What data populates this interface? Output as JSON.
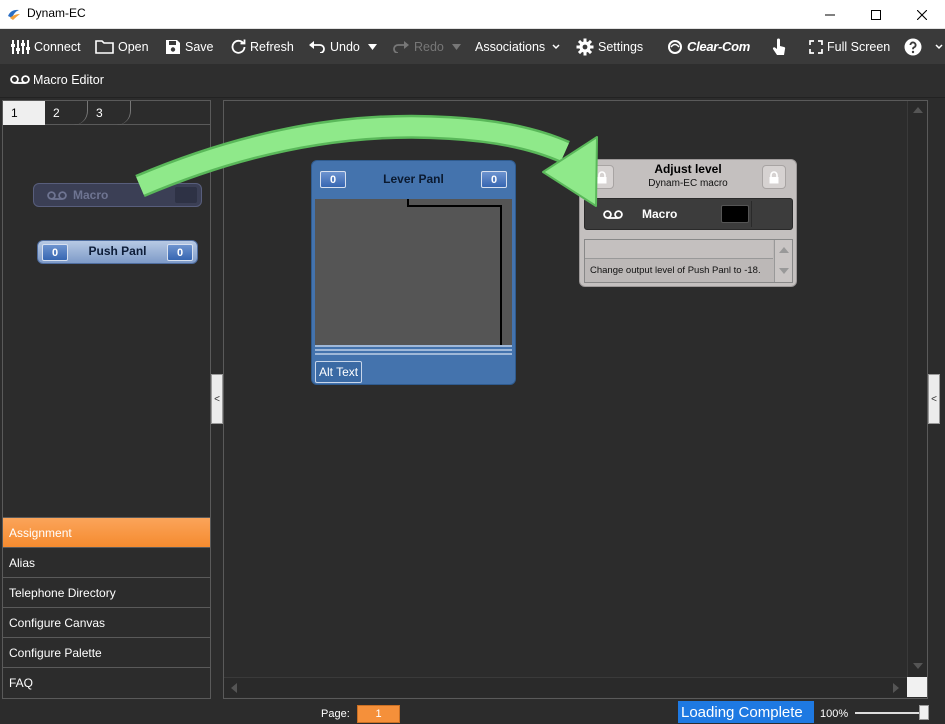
{
  "window": {
    "title": "Dynam-EC"
  },
  "toolbar": {
    "connect": "Connect",
    "open": "Open",
    "save": "Save",
    "refresh": "Refresh",
    "undo": "Undo",
    "redo": "Redo",
    "associations": "Associations",
    "settings": "Settings",
    "brand": "Clear-Com",
    "full_screen": "Full Screen"
  },
  "subbar": {
    "label": "Macro Editor"
  },
  "palette": {
    "tabs": [
      "1",
      "2",
      "3"
    ],
    "macro_chip": {
      "label": "Macro"
    },
    "push_chip": {
      "label": "Push Panl",
      "left_value": "0",
      "right_value": "0"
    }
  },
  "menu": [
    "Assignment",
    "Alias",
    "Telephone Directory",
    "Configure Canvas",
    "Configure Palette",
    "FAQ"
  ],
  "collapse_glyph": "<",
  "lever_panel": {
    "title": "Lever Panl",
    "left_value": "0",
    "right_value": "0",
    "alt_text": "Alt Text"
  },
  "macro_panel": {
    "title": "Adjust level",
    "subtitle": "Dynam-EC macro",
    "macro_label": "Macro",
    "description": "Change output level of Push Panl to -18."
  },
  "status": {
    "page_label": "Page:",
    "page_value": "1",
    "loading": "Loading Complete",
    "zoom": "100%",
    "zoom_level": 1.0
  },
  "colors": {
    "accent": "#f5903a",
    "selected_blue": "#1e79e2",
    "arrow_green": "#8fe98a",
    "lever_blue": "#4473ad"
  }
}
